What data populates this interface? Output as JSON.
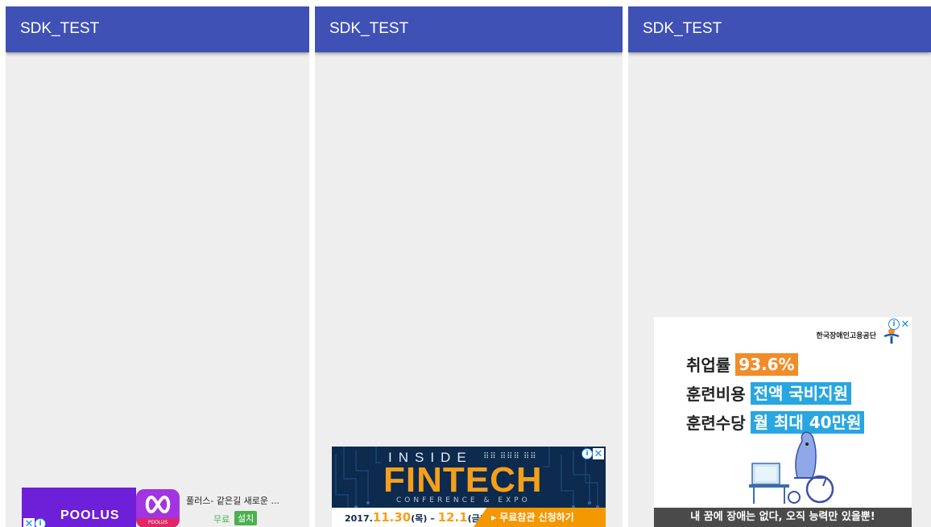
{
  "screens": [
    {
      "app_title": "SDK_TEST",
      "ad": {
        "brand_logo": "POOLUS",
        "app_icon_label": "POOLUS",
        "title": "풀러스- 같은길 새로운 ...",
        "price": "무료",
        "install_label": "설치"
      }
    },
    {
      "app_title": "SDK_TEST",
      "ad": {
        "inside": "INSIDE",
        "headline": "FINTECH",
        "subline": "CONFERENCE & EXPO",
        "date_year": "2017.",
        "date_start": "11.30",
        "date_start_day": "(목)",
        "date_sep": " – ",
        "date_end": "12.1",
        "date_end_day": "(금)",
        "cta": "▸ 무료참관 신청하기"
      }
    },
    {
      "app_title": "SDK_TEST",
      "ad": {
        "org": "한국장애인고용공단",
        "rows": [
          {
            "label": "취업률",
            "value": "93.6%"
          },
          {
            "label": "훈련비용",
            "value": "전액 국비지원"
          },
          {
            "label": "훈련수당",
            "value": "월 최대 40만원"
          }
        ],
        "footer": "내 꿈에 장애는 없다, 오직 능력만 있을뿐!"
      }
    }
  ],
  "adchoices": {
    "info_icon": "ⓘ",
    "close_icon": "✕"
  },
  "colors": {
    "appbar": "#3f51b5",
    "background": "#eeeeee",
    "poolus_purple": "#6e1fd8",
    "fintech_orange": "#f5a01a",
    "install_green": "#4caf50"
  }
}
